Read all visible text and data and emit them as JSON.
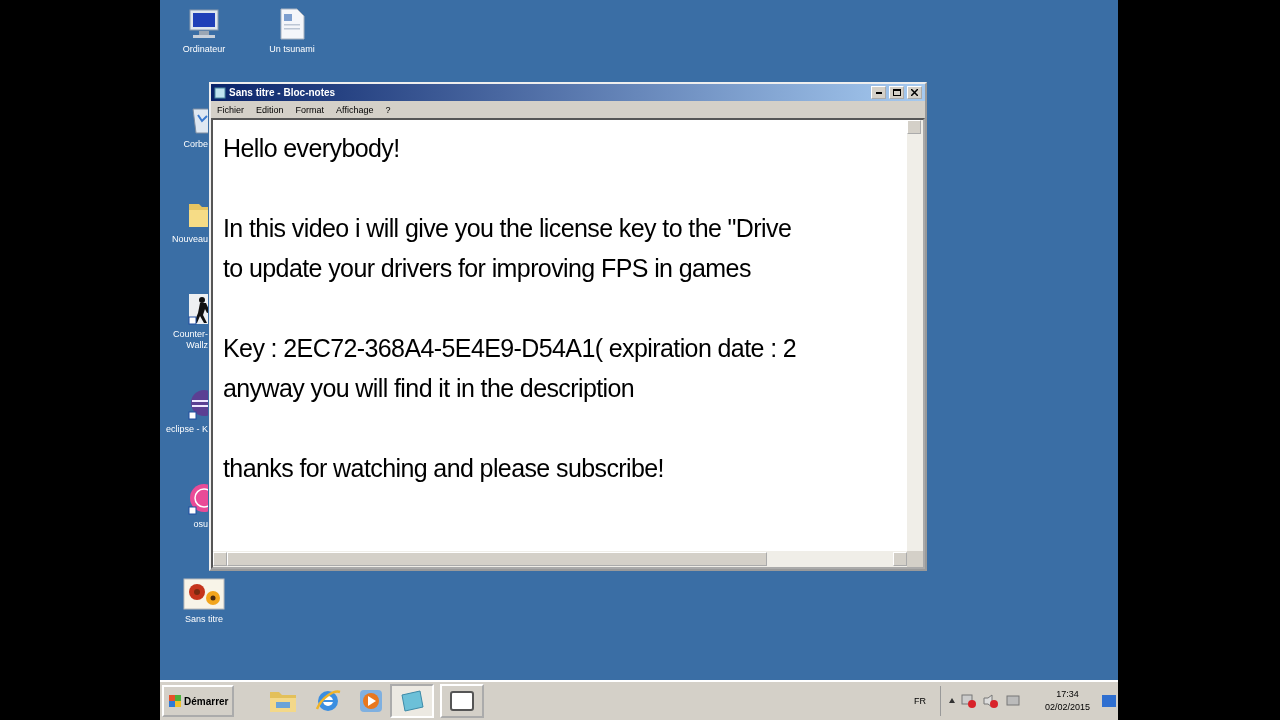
{
  "desktop_icons": [
    {
      "kind": "computer",
      "covered": false,
      "label_lines": [
        "Ordinateur"
      ]
    },
    {
      "kind": "recycle",
      "covered": true,
      "label_lines": [
        "Corbe"
      ]
    },
    {
      "kind": "folder",
      "covered": true,
      "label_lines": [
        "Nouveau"
      ]
    },
    {
      "kind": "game",
      "covered": true,
      "label_lines": [
        "Counter-",
        "Wallz"
      ]
    },
    {
      "kind": "eclipse",
      "covered": true,
      "label_lines": [
        "eclipse - K"
      ]
    },
    {
      "kind": "osu",
      "covered": true,
      "label_lines": [
        "osu"
      ]
    },
    {
      "kind": "image",
      "covered": false,
      "label_lines": [
        "Sans titre"
      ]
    },
    {
      "kind": "document",
      "covered": false,
      "label_lines": [
        "Un tsunami"
      ]
    }
  ],
  "notepad": {
    "title": "Sans titre - Bloc-notes",
    "menu": [
      "Fichier",
      "Edition",
      "Format",
      "Affichage",
      "?"
    ],
    "paragraphs": [
      [
        "Hello everybody!"
      ],
      [
        "In this video i will give you the license key to the \"Drive",
        "to update your drivers for improving FPS in games"
      ],
      [
        "Key : 2EC72-368A4-5E4E9-D54A1( expiration date : 2",
        "anyway you will find it in the description"
      ],
      [
        "thanks for watching and please subscribe!"
      ]
    ]
  },
  "taskbar": {
    "start": "Démarrer",
    "quick_launch": [
      {
        "kind": "folder"
      },
      {
        "kind": "browser"
      },
      {
        "kind": "media"
      }
    ],
    "tasks": [
      {
        "kind": "notepad",
        "selected": true
      },
      {
        "kind": "paint",
        "selected": false
      }
    ],
    "language": "FR",
    "time": "17:34",
    "date": "02/02/2015"
  }
}
